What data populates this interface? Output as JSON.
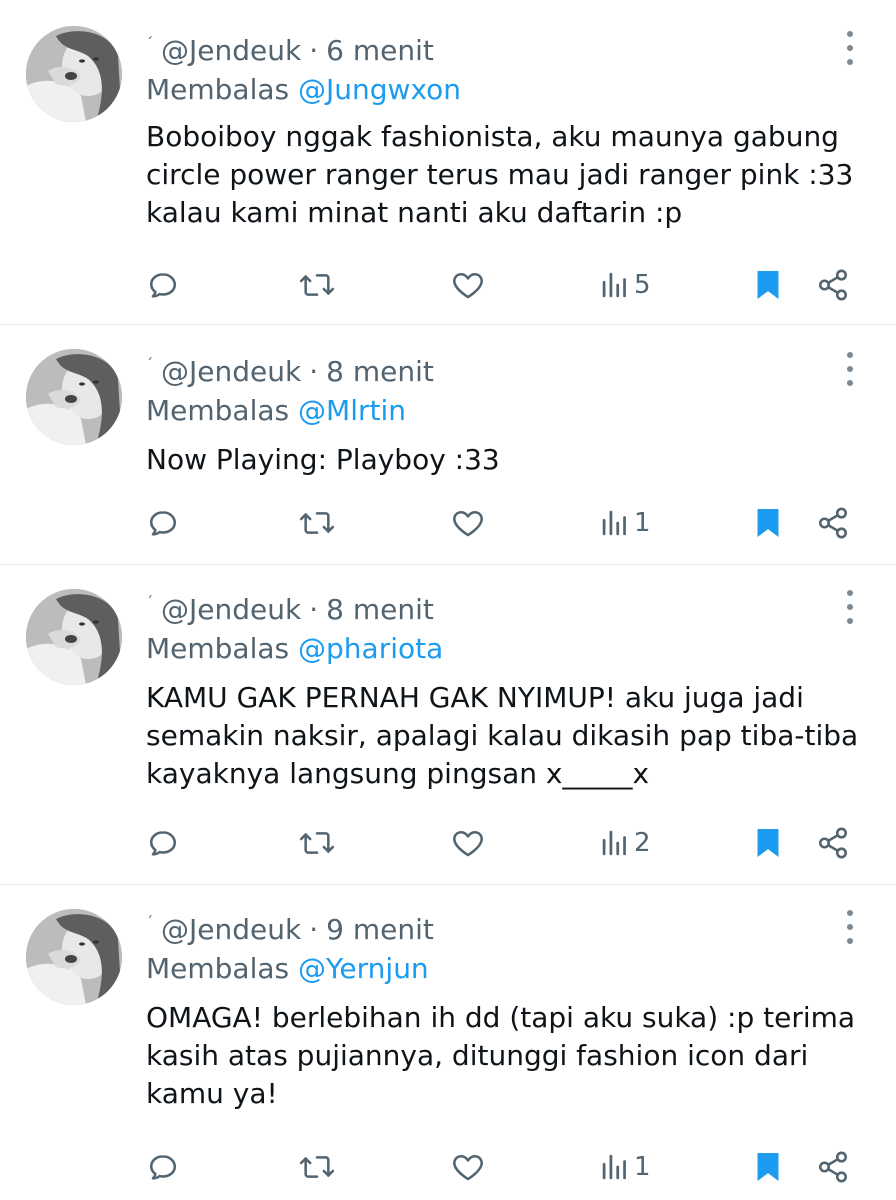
{
  "colors": {
    "text_primary": "#0f1419",
    "text_secondary": "#536471",
    "mention": "#1d9bf0",
    "bookmark": "#1d9bf0",
    "divider": "#e6ecf0"
  },
  "icons": {
    "reply": "reply-icon",
    "retweet": "retweet-icon",
    "like": "heart-icon",
    "views": "views-icon",
    "bookmark": "bookmark-icon",
    "share": "share-icon",
    "more": "more-icon"
  },
  "tweets": [
    {
      "handle": "@Jendeuk",
      "time": "6 menit",
      "reply_prefix": "Membalas",
      "reply_to": "@Jungwxon",
      "lines": [
        "Boboiboy nggak fashionista, aku maunya gabung",
        "circle power ranger terus mau jadi ranger pink :33",
        "kalau kami minat nanti aku daftarin :p"
      ],
      "views": "5"
    },
    {
      "handle": "@Jendeuk",
      "time": "8 menit",
      "reply_prefix": "Membalas",
      "reply_to": "@Mlrtin",
      "lines": [
        "Now Playing: Playboy :33"
      ],
      "views": "1"
    },
    {
      "handle": "@Jendeuk",
      "time": "8 menit",
      "reply_prefix": "Membalas",
      "reply_to": "@phariota",
      "lines": [
        "KAMU GAK PERNAH GAK NYIMUP! aku juga jadi",
        "semakin naksir, apalagi kalau dikasih pap tiba-tiba",
        "kayaknya langsung pingsan x_____x"
      ],
      "views": "2"
    },
    {
      "handle": "@Jendeuk",
      "time": "9 menit",
      "reply_prefix": "Membalas",
      "reply_to": "@Yernjun",
      "lines": [
        "OMAGA! berlebihan ih dd (tapi aku suka) :p terima",
        "kasih atas pujiannya, ditunggi fashion icon dari",
        "kamu ya!"
      ],
      "views": "1"
    }
  ]
}
